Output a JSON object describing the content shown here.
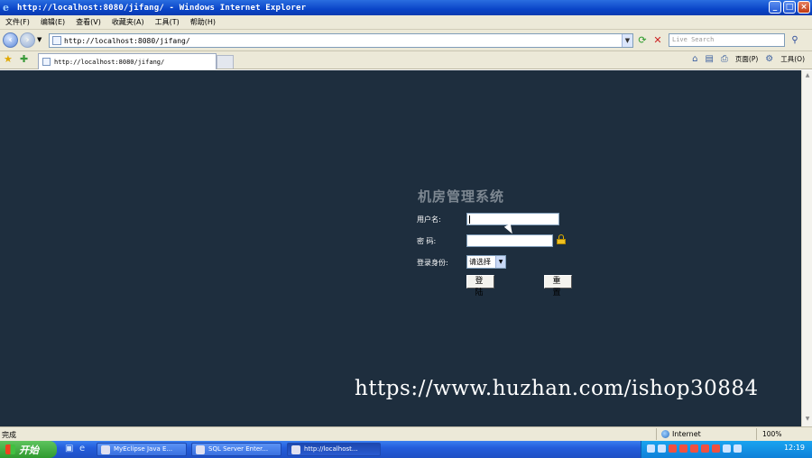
{
  "window": {
    "title": "http://localhost:8080/jifang/ - Windows Internet Explorer",
    "min": "_",
    "max": "□",
    "close": "×"
  },
  "menu": [
    "文件(F)",
    "编辑(E)",
    "查看(V)",
    "收藏夹(A)",
    "工具(T)",
    "帮助(H)"
  ],
  "address": {
    "url": "http://localhost:8080/jifang/",
    "search_placeholder": "Live Search"
  },
  "tab": {
    "label": "http://localhost:8080/jifang/"
  },
  "tools": {
    "page": "页面(P)",
    "tools": "工具(O)"
  },
  "login": {
    "system_title": "机房管理系统",
    "username_label": "用户名:",
    "password_label": "密 码:",
    "role_label": "登录身份:",
    "role_selected": "请选择",
    "login_button": "登 陆",
    "reset_button": "重 置"
  },
  "watermark": "https://www.huzhan.com/ishop30884",
  "status": {
    "text": "完成",
    "zone": "Internet",
    "zoom": "100%"
  },
  "taskbar": {
    "start": "开始",
    "tasks": [
      "MyEclipse Java E...",
      "SQL Server Enter...",
      "http://localhost..."
    ],
    "clock": "12:19"
  }
}
